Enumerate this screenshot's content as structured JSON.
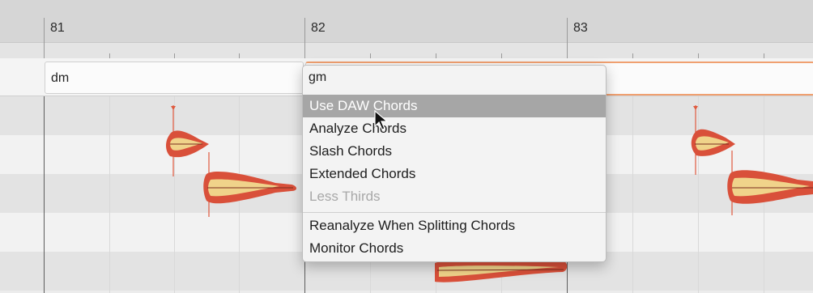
{
  "ruler": {
    "bars": [
      "81",
      "82",
      "83"
    ]
  },
  "chords": {
    "first": "dm",
    "second": "gm"
  },
  "menu": {
    "current_chord": "gm",
    "items": [
      {
        "label": "Use DAW Chords",
        "state": "highlighted"
      },
      {
        "label": "Analyze Chords",
        "state": "normal"
      },
      {
        "label": "Slash Chords",
        "state": "normal"
      },
      {
        "label": "Extended Chords",
        "state": "normal"
      },
      {
        "label": "Less Thirds",
        "state": "disabled"
      },
      {
        "label": "Reanalyze When Splitting Chords",
        "state": "normal"
      },
      {
        "label": "Monitor Chords",
        "state": "normal"
      }
    ]
  },
  "colors": {
    "blob_outer": "#d9503a",
    "blob_inner": "#f0d38a",
    "selection_border": "#f0a070"
  },
  "icons": {
    "cursor": "mouse-pointer-icon"
  }
}
